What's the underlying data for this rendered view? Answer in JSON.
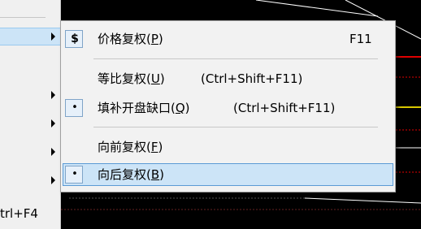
{
  "parent_menu": {
    "shortcut_text": "trl+F4",
    "highlight_arrow": "submenu-arrow-icon"
  },
  "submenu": {
    "items": [
      {
        "label": "价格复权(",
        "mnemonic": "P",
        "suffix": ")",
        "shortcut": "F11",
        "mark": "$",
        "mark_icon": "dollar-icon"
      },
      {
        "label": "等比复权(",
        "mnemonic": "U",
        "suffix": ")",
        "shortcut": "(Ctrl+Shift+F11)",
        "mark": ""
      },
      {
        "label": "填补开盘缺口(",
        "mnemonic": "Q",
        "suffix": ")",
        "shortcut": "(Ctrl+Shift+F11)",
        "mark": "•"
      },
      {
        "label": "向前复权(",
        "mnemonic": "F",
        "suffix": ")",
        "shortcut": "",
        "mark": ""
      },
      {
        "label": "向后复权(",
        "mnemonic": "B",
        "suffix": ")",
        "shortcut": "",
        "mark": "•",
        "selected": true
      }
    ]
  },
  "colors": {
    "chart_background": "#000000",
    "menu_background": "#f2f2f2",
    "selection_fill": "#cce4f7",
    "selection_border": "#5b9ad5",
    "chart_red": "#e00000",
    "chart_yellow": "#d8c800",
    "chart_white": "#ffffff"
  }
}
